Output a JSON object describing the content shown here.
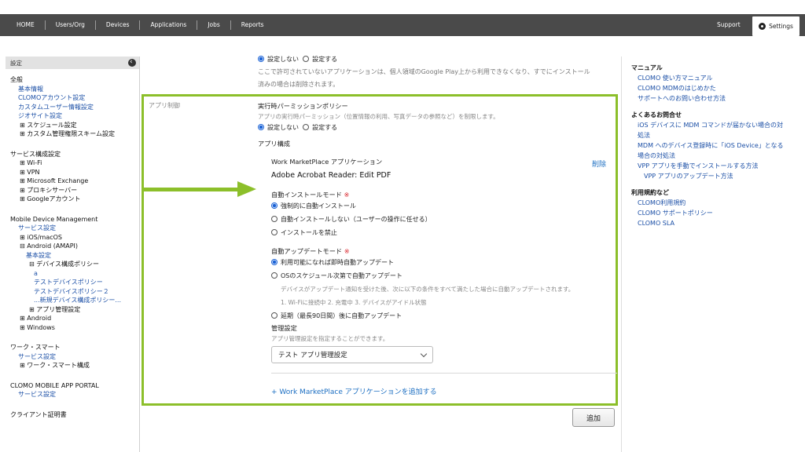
{
  "topnav": {
    "items": [
      "HOME",
      "Users/Org",
      "Devices",
      "Applications",
      "Jobs",
      "Reports"
    ],
    "support": "Support",
    "settings": "Settings"
  },
  "sidebar": {
    "title": "設定",
    "groups": [
      {
        "heading": "全般",
        "items": [
          {
            "label": "基本情報",
            "type": "link"
          },
          {
            "label": "CLOMOアカウント設定",
            "type": "link"
          },
          {
            "label": "カスタムユーザー情報設定",
            "type": "link"
          },
          {
            "label": "ジオサイト設定",
            "type": "link"
          },
          {
            "label": "⊞ スケジュール設定",
            "type": "tree"
          },
          {
            "label": "⊞ カスタム管理権限スキーム設定",
            "type": "tree"
          }
        ]
      },
      {
        "heading": "サービス構成設定",
        "items": [
          {
            "label": "⊞ Wi-Fi",
            "type": "tree"
          },
          {
            "label": "⊞ VPN",
            "type": "tree"
          },
          {
            "label": "⊞ Microsoft Exchange",
            "type": "tree"
          },
          {
            "label": "⊞ プロキシサーバー",
            "type": "tree"
          },
          {
            "label": "⊞ Googleアカウント",
            "type": "tree"
          }
        ]
      },
      {
        "heading": "Mobile Device Management",
        "items": [
          {
            "label": "サービス設定",
            "type": "link"
          },
          {
            "label": "⊞ iOS/macOS",
            "type": "tree"
          },
          {
            "label": "⊟ Android (AMAPI)",
            "type": "tree"
          },
          {
            "label": "基本設定",
            "type": "link2"
          },
          {
            "label": "⊟ デバイス構成ポリシー",
            "type": "tree2"
          },
          {
            "label": "a",
            "type": "link3"
          },
          {
            "label": "テストデバイスポリシー",
            "type": "link3"
          },
          {
            "label": "テストデバイスポリシー２",
            "type": "link3"
          },
          {
            "label": "...新規デバイス構成ポリシー...",
            "type": "link3"
          },
          {
            "label": "⊞ アプリ管理設定",
            "type": "tree2"
          },
          {
            "label": "⊞ Android",
            "type": "tree"
          },
          {
            "label": "⊞ Windows",
            "type": "tree"
          }
        ]
      },
      {
        "heading": "ワーク・スマート",
        "items": [
          {
            "label": "サービス設定",
            "type": "link"
          },
          {
            "label": "⊞ ワーク・スマート構成",
            "type": "tree"
          }
        ]
      },
      {
        "heading": "CLOMO MOBILE APP PORTAL",
        "items": [
          {
            "label": "サービス設定",
            "type": "link"
          }
        ]
      },
      {
        "heading": "クライアント証明書",
        "items": []
      }
    ]
  },
  "main": {
    "top_radio_off": "設定しない",
    "top_radio_on": "設定する",
    "top_note_1": "ここで許可されていないアプリケーションは、個人領域のGoogle Play上から利用できなくなり、すでにインストール",
    "top_note_2": "済みの場合は削除されます。",
    "panel_label": "アプリ制御",
    "perm_title": "実行時パーミッションポリシー",
    "perm_desc": "アプリの実行時パーミッション（位置情報の利用、写真データの参照など）を制限します。",
    "perm_opt_off": "設定しない",
    "perm_opt_on": "設定する",
    "app_config": "アプリ構成",
    "wmp_app": "Work MarketPlace アプリケーション",
    "delete": "削除",
    "app_name": "Adobe Acrobat Reader: Edit PDF",
    "install_mode": "自動インストールモード",
    "required_mark": "※",
    "install_opts": [
      "強制的に自動インストール",
      "自動インストールしない（ユーザーの操作に任せる）",
      "インストールを禁止"
    ],
    "update_mode": "自動アップデートモード",
    "update_opt_1": "利用可能になれば即時自動アップデート",
    "update_opt_2": "OSのスケジュール次第で自動アップデート",
    "update_note_1": "デバイスがアップデート通知を受けた後、次に以下の条件をすべて満たした場合に自動アップデートされます。",
    "update_note_2": "1. Wi-Fiに接続中 2. 充電中 3. デバイスがアイドル状態",
    "update_opt_3": "延期（最長90日間）後に自動アップデート",
    "mgmt_title": "管理設定",
    "mgmt_desc": "アプリ管理設定を指定することができます。",
    "mgmt_select": "テスト アプリ管理設定",
    "add_app": "+ Work MarketPlace アプリケーションを追加する",
    "add_button": "追加"
  },
  "rightbar": {
    "sections": [
      {
        "heading": "マニュアル",
        "links": [
          {
            "label": "CLOMO 使い方マニュアル",
            "indent": 1
          },
          {
            "label": "CLOMO MDMのはじめかた",
            "indent": 1
          },
          {
            "label": "サポートへのお問い合わせ方法",
            "indent": 1
          }
        ]
      },
      {
        "heading": "よくあるお問合せ",
        "links": [
          {
            "label": "iOS デバイスに MDM コマンドが届かない場合の対",
            "indent": 1
          },
          {
            "label": "処法",
            "indent": 1
          },
          {
            "label": "MDM へのデバイス登録時に「iOS Device」となる",
            "indent": 1
          },
          {
            "label": "場合の対処法",
            "indent": 1
          },
          {
            "label": "VPP アプリを手動でインストールする方法",
            "indent": 1
          },
          {
            "label": "VPP アプリのアップデート方法",
            "indent": 2
          }
        ]
      },
      {
        "heading": "利用規約など",
        "links": [
          {
            "label": "CLOMO利用規約",
            "indent": 1
          },
          {
            "label": "CLOMO サポートポリシー",
            "indent": 1
          },
          {
            "label": "CLOMO SLA",
            "indent": 1
          }
        ]
      }
    ]
  },
  "colors": {
    "accent_green": "#8cbf2a",
    "link_blue": "#1b4fa6",
    "topbar": "#4a4a4a"
  }
}
